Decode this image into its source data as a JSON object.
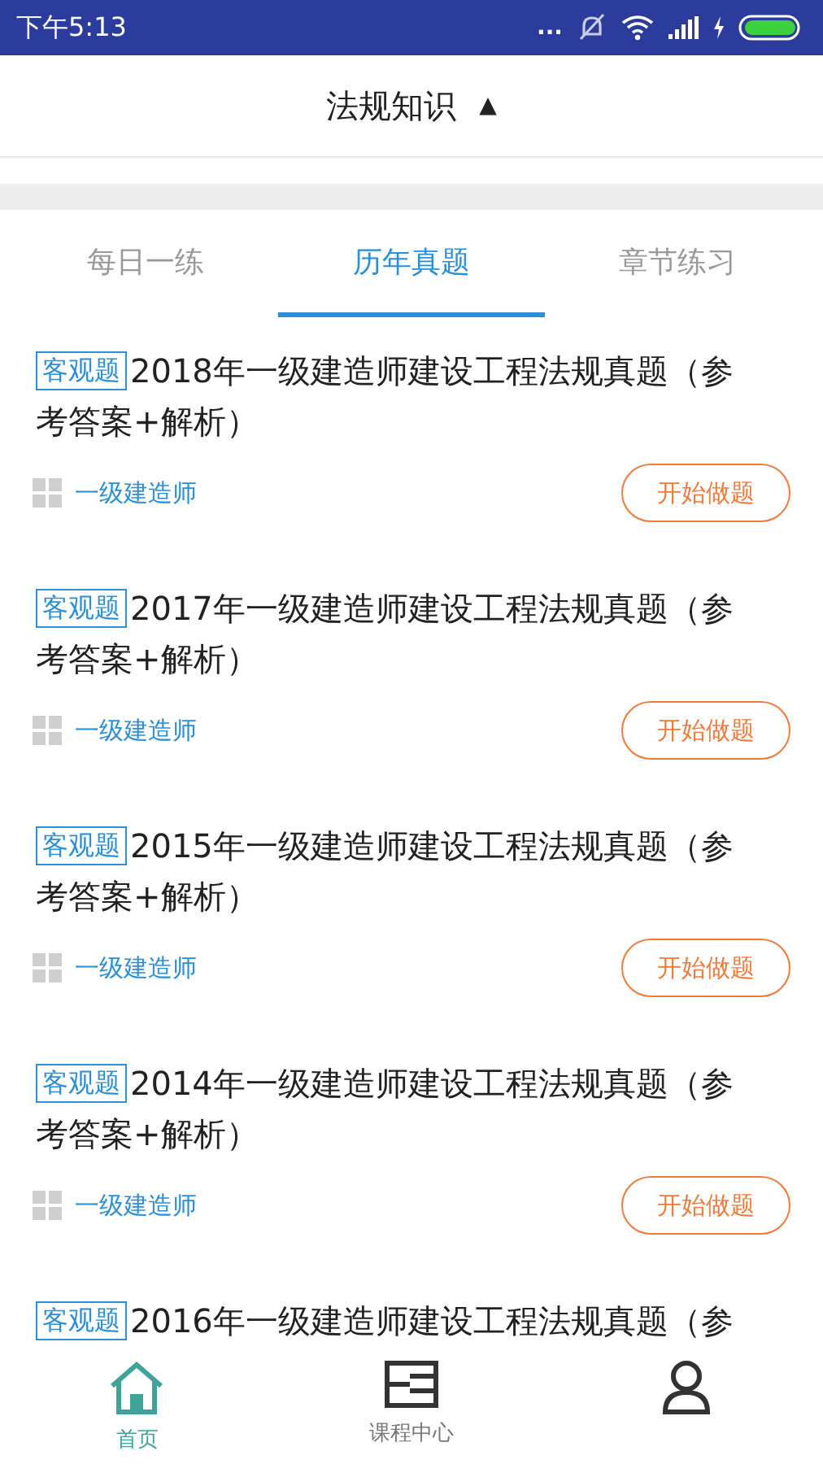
{
  "status_bar": {
    "time": "下午5:13",
    "dots": "..."
  },
  "header": {
    "title": "法规知识",
    "caret": "▲"
  },
  "tabs": [
    {
      "label": "每日一练",
      "selected": false
    },
    {
      "label": "历年真题",
      "selected": true
    },
    {
      "label": "章节练习",
      "selected": false
    }
  ],
  "items": [
    {
      "tag": "客观题",
      "title": "2018年一级建造师建设工程法规真题（参考答案+解析）",
      "category": "一级建造师",
      "button": "开始做题"
    },
    {
      "tag": "客观题",
      "title": "2017年一级建造师建设工程法规真题（参考答案+解析）",
      "category": "一级建造师",
      "button": "开始做题"
    },
    {
      "tag": "客观题",
      "title": "2015年一级建造师建设工程法规真题（参考答案+解析）",
      "category": "一级建造师",
      "button": "开始做题"
    },
    {
      "tag": "客观题",
      "title": "2014年一级建造师建设工程法规真题（参考答案+解析）",
      "category": "一级建造师",
      "button": "开始做题"
    },
    {
      "tag": "客观题",
      "title": "2016年一级建造师建设工程法规真题（参"
    }
  ],
  "nav": [
    {
      "kind": "home",
      "label": "首页",
      "selected": true
    },
    {
      "kind": "courses",
      "label": "课程中心",
      "selected": false
    },
    {
      "kind": "profile",
      "selected": false
    }
  ]
}
